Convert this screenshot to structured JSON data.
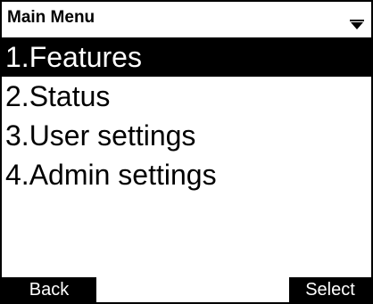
{
  "header": {
    "title": "Main Menu",
    "scroll_icon": "scroll-down-arrow-icon"
  },
  "menu": {
    "selected_index": 0,
    "items": [
      {
        "label": "1.Features"
      },
      {
        "label": "2.Status"
      },
      {
        "label": "3.User settings"
      },
      {
        "label": "4.Admin settings"
      }
    ]
  },
  "softkeys": {
    "left_label": "Back",
    "right_label": "Select"
  },
  "colors": {
    "foreground": "#000000",
    "background": "#ffffff",
    "highlight": "#000000",
    "highlight_text": "#ffffff"
  }
}
